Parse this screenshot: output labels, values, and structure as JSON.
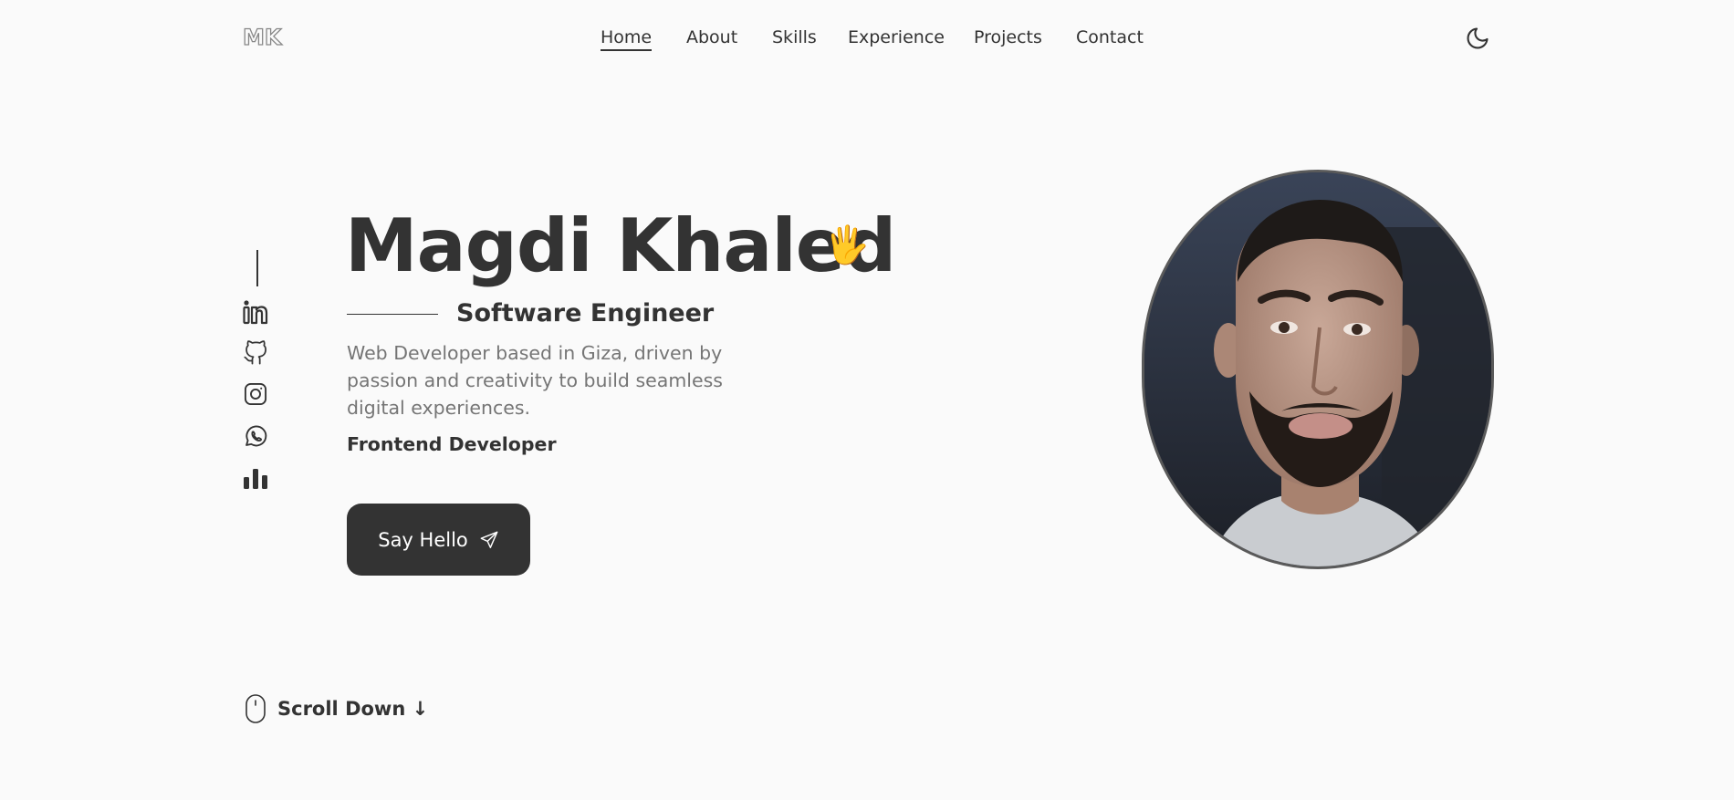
{
  "header": {
    "logo_text": "MK",
    "nav": [
      {
        "label": "Home",
        "active": true
      },
      {
        "label": "About"
      },
      {
        "label": "Skills"
      },
      {
        "label": "Experience"
      },
      {
        "label": "Projects"
      },
      {
        "label": "Contact"
      }
    ],
    "theme_icon": "moon-icon"
  },
  "social": {
    "icons": [
      "linkedin-icon",
      "github-icon",
      "instagram-icon",
      "whatsapp-icon",
      "bar-chart-icon"
    ]
  },
  "hero": {
    "name": "Magdi Khaled",
    "wave": "🖐",
    "role": "Software Engineer",
    "description": "Web Developer based in Giza, driven by passion and creativity to build seamless digital experiences.",
    "subtitle": "Frontend Developer",
    "cta_label": "Say Hello",
    "cta_icon": "send-icon"
  },
  "scroll": {
    "label": "Scroll Down ↓",
    "icon": "mouse-icon"
  },
  "colors": {
    "background": "#fafafa",
    "text": "#333333",
    "muted": "#757575",
    "button": "#333333"
  }
}
